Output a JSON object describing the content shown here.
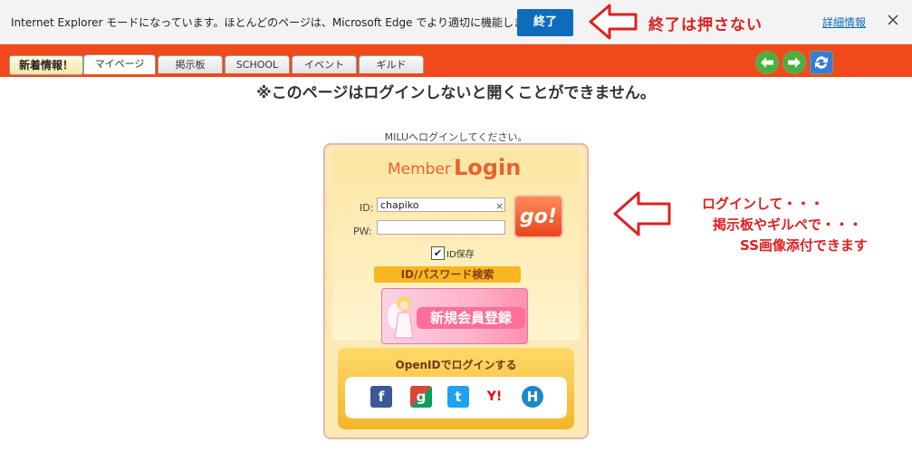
{
  "ie_bar": {
    "message": "Internet Explorer モードになっています。ほとんどのページは、Microsoft Edge でより適切に機能します。",
    "end_button": "終了",
    "details_link": "詳細情報",
    "close_icon": "close-icon"
  },
  "annotations": {
    "end_note": "終了は押さない",
    "login_note_lines": [
      "ログインして・・・",
      "掲示板やギルペで・・・",
      "SS画像添付できます"
    ],
    "color": "#e02020"
  },
  "tabbar": {
    "new_info": "新着情報！",
    "tabs": [
      "マイページ",
      "掲示板",
      "SCHOOL",
      "イベント",
      "ギルド"
    ],
    "nav_icons": [
      "back-arrow-icon",
      "forward-arrow-icon",
      "refresh-icon"
    ],
    "color": "#f04a1a"
  },
  "main": {
    "notice": "※このページはログインしないと開くことができません。",
    "prompt": "MILUへログインしてください。"
  },
  "login": {
    "title_member": "Member",
    "title_login": "Login",
    "id_label": "ID:",
    "id_value": "chapiko",
    "id_clear": "×",
    "pw_label": "PW:",
    "pw_value": "",
    "go_label": "go!",
    "remember_checked": "✔",
    "remember_label": "ID保存",
    "forgot_label": "ID/パスワード検索",
    "register_label": "新規会員登録"
  },
  "openid": {
    "title": "OpenIDでログインする",
    "providers": [
      {
        "icon": "facebook-icon",
        "glyph": "f"
      },
      {
        "icon": "google-icon",
        "glyph": "g"
      },
      {
        "icon": "twitter-icon",
        "glyph": "t"
      },
      {
        "icon": "yahoo-icon",
        "glyph": "Y!"
      },
      {
        "icon": "hatena-icon",
        "glyph": "H"
      }
    ]
  }
}
